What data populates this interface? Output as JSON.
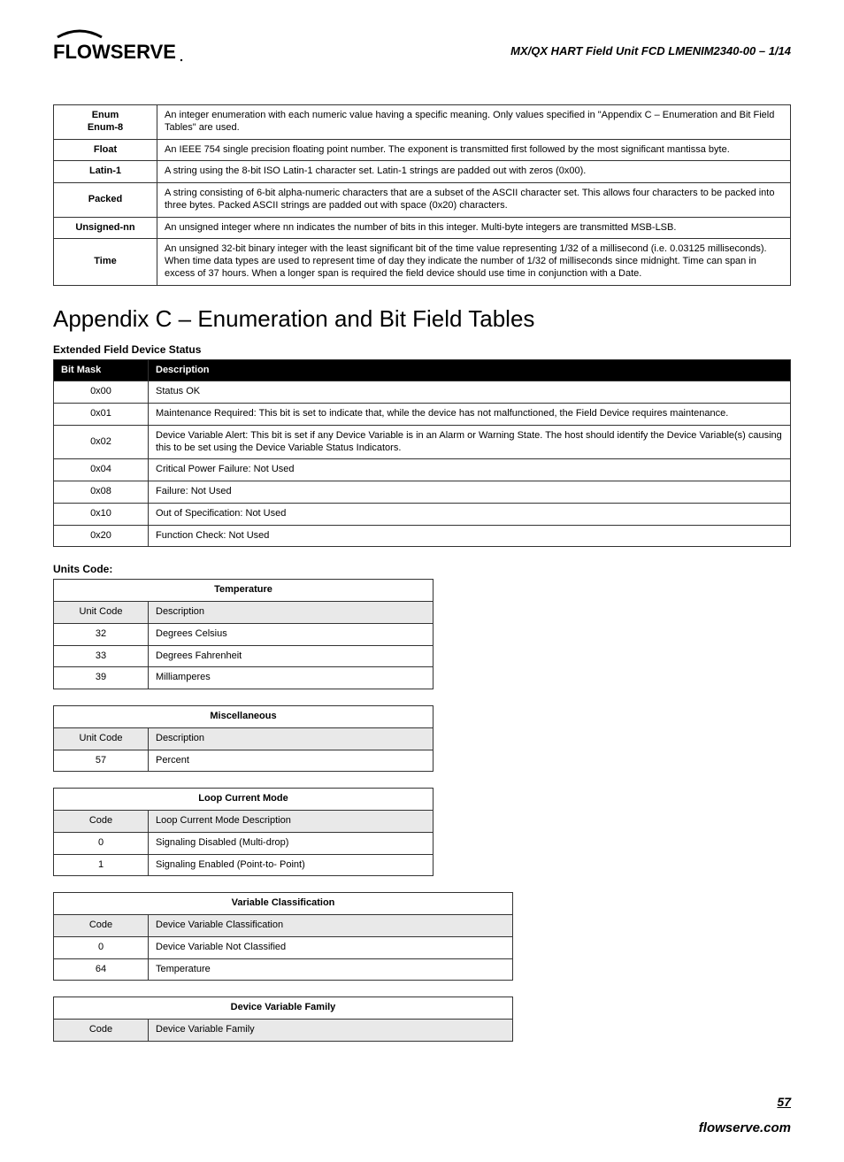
{
  "header": {
    "doc_title": "MX/QX HART Field Unit    FCD LMENIM2340-00 – 1/14",
    "logo_text": "FLOWSERVE"
  },
  "types_table": {
    "rows": [
      {
        "name": "Enum\nEnum-8",
        "desc": "An integer enumeration with each numeric value having a specific meaning. Only values specified in \"Appendix C – Enumeration and Bit Field Tables\" are used."
      },
      {
        "name": "Float",
        "desc": "An IEEE 754 single precision floating point number. The exponent is transmitted first followed by the most significant mantissa byte."
      },
      {
        "name": "Latin-1",
        "desc": "A string using the 8-bit ISO Latin-1 character set. Latin-1 strings are padded out with zeros (0x00)."
      },
      {
        "name": "Packed",
        "desc": "A string consisting of 6-bit alpha-numeric characters that are a subset of the ASCII character set. This allows four characters to be packed into three bytes. Packed ASCII strings are padded out with space (0x20) characters."
      },
      {
        "name": "Unsigned-nn",
        "desc": "An unsigned integer where nn indicates the number of bits in this integer. Multi-byte integers are transmitted MSB-LSB."
      },
      {
        "name": "Time",
        "desc": "An unsigned 32-bit binary integer with the least significant bit of the time value representing 1/32 of a millisecond (i.e. 0.03125 milliseconds). When time data types are used to represent time of day they indicate the number of 1/32 of milliseconds since midnight. Time can span in excess of 37 hours. When a longer span is required the field device should use time in conjunction with a Date."
      }
    ]
  },
  "appendix_title": "Appendix C – Enumeration and Bit Field Tables",
  "status": {
    "heading": "Extended Field Device Status",
    "col1": "Bit Mask",
    "col2": "Description",
    "rows": [
      {
        "mask": "0x00",
        "desc": "Status OK"
      },
      {
        "mask": "0x01",
        "desc": "Maintenance Required: This bit is set to indicate that, while the device has not malfunctioned, the Field Device requires maintenance."
      },
      {
        "mask": "0x02",
        "desc": "Device Variable Alert: This bit is set if any Device Variable is in an Alarm or Warning State. The host should identify the Device Variable(s) causing this to be set using the Device Variable Status Indicators."
      },
      {
        "mask": "0x04",
        "desc": "Critical Power Failure: Not Used"
      },
      {
        "mask": "0x08",
        "desc": "Failure: Not Used"
      },
      {
        "mask": "0x10",
        "desc": "Out of Specification: Not Used"
      },
      {
        "mask": "0x20",
        "desc": "Function Check: Not Used"
      }
    ]
  },
  "units_heading": "Units Code:",
  "temperature": {
    "title": "Temperature",
    "h1": "Unit Code",
    "h2": "Description",
    "rows": [
      {
        "code": "32",
        "desc": "Degrees Celsius"
      },
      {
        "code": "33",
        "desc": "Degrees Fahrenheit"
      },
      {
        "code": "39",
        "desc": "Milliamperes"
      }
    ]
  },
  "misc": {
    "title": "Miscellaneous",
    "h1": "Unit Code",
    "h2": "Description",
    "rows": [
      {
        "code": "57",
        "desc": "Percent"
      }
    ]
  },
  "loop": {
    "title": "Loop Current Mode",
    "h1": "Code",
    "h2": "Loop Current Mode Description",
    "rows": [
      {
        "code": "0",
        "desc": "Signaling Disabled (Multi-drop)"
      },
      {
        "code": "1",
        "desc": "Signaling Enabled (Point-to- Point)"
      }
    ]
  },
  "varclass": {
    "title": "Variable Classification",
    "h1": "Code",
    "h2": "Device Variable Classification",
    "rows": [
      {
        "code": "0",
        "desc": "Device Variable Not Classified"
      },
      {
        "code": "64",
        "desc": "Temperature"
      }
    ]
  },
  "dvf": {
    "title": "Device Variable Family",
    "h1": "Code",
    "h2": "Device Variable Family"
  },
  "page_num": "57",
  "footer_url": "flowserve.com"
}
